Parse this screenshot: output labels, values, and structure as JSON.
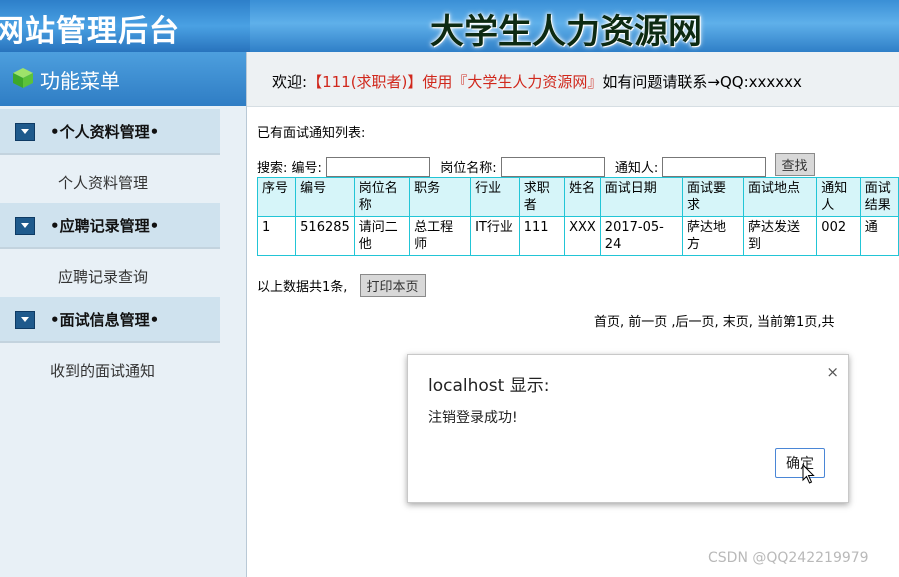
{
  "header": {
    "left_title": "网站管理后台",
    "site_title": "大学生人力资源网"
  },
  "sidebar": {
    "menu_title": "功能菜单",
    "groups": [
      {
        "label": "•个人资料管理•",
        "items": [
          "个人资料管理"
        ]
      },
      {
        "label": "•应聘记录管理•",
        "items": [
          "应聘记录查询"
        ]
      },
      {
        "label": "•面试信息管理•",
        "items": [
          "收到的面试通知"
        ]
      }
    ]
  },
  "welcome": {
    "prefix": "欢迎:",
    "user": "【111(求职者)】使用『大学生人力资源网』",
    "suffix": "如有问题请联系→QQ:xxxxxx"
  },
  "content": {
    "list_title": "已有面试通知列表:",
    "search": {
      "label": "搜索:",
      "field1_label": "编号:",
      "field2_label": "岗位名称:",
      "field3_label": "通知人:",
      "field1_value": "",
      "field2_value": "",
      "field3_value": "",
      "button": "查找"
    },
    "table": {
      "headers": [
        "序号",
        "编号",
        "岗位名称",
        "职务",
        "行业",
        "求职者",
        "姓名",
        "面试日期",
        "面试要求",
        "面试地点",
        "通知人",
        "面试结果"
      ],
      "rows": [
        [
          "1",
          "516285",
          "请问二他",
          "总工程师",
          "IT行业",
          "111",
          "XXX",
          "2017-05-24",
          "萨达地方",
          "萨达发送到",
          "002",
          "通"
        ]
      ]
    },
    "summary": "以上数据共1条,",
    "print_button": "打印本页",
    "pager": "首页, 前一页 ,后一页, 末页, 当前第1页,共"
  },
  "dialog": {
    "title": "localhost 显示:",
    "message": "注销登录成功!",
    "ok_button": "确定",
    "close_symbol": "×"
  },
  "watermark": "CSDN @QQ242219979"
}
